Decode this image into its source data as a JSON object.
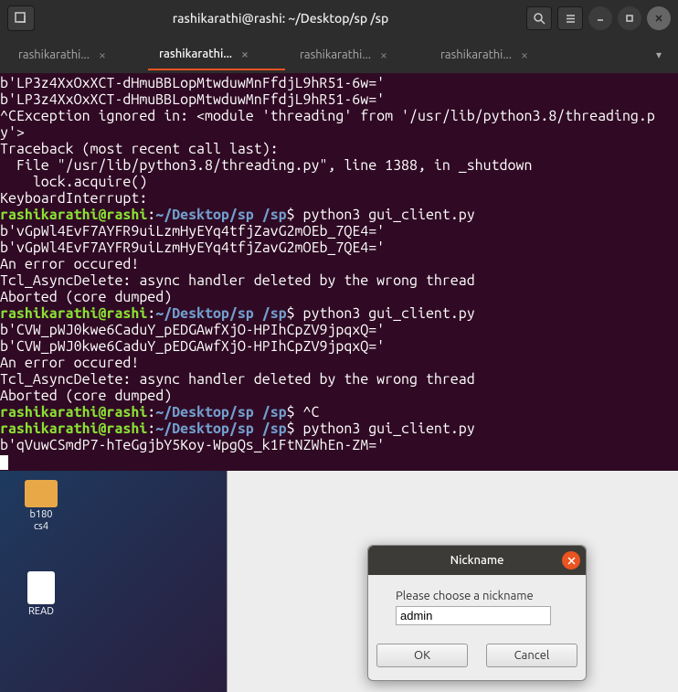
{
  "titlebar": {
    "title": "rashikarathi@rashi: ~/Desktop/sp /sp"
  },
  "tabs": [
    {
      "label": "rashikarathi...",
      "active": false
    },
    {
      "label": "rashikarathi...",
      "active": true
    },
    {
      "label": "rashikarathi...",
      "active": false
    },
    {
      "label": "rashikarathi...",
      "active": false
    }
  ],
  "terminal": {
    "lines": [
      {
        "type": "txt",
        "text": "b'LP3z4XxOxXCT-dHmuBBLopMtwduwMnFfdjL9hR51-6w='"
      },
      {
        "type": "txt",
        "text": "b'LP3z4XxOxXCT-dHmuBBLopMtwduwMnFfdjL9hR51-6w='"
      },
      {
        "type": "txt",
        "text": "^CException ignored in: <module 'threading' from '/usr/lib/python3.8/threading.p"
      },
      {
        "type": "txt",
        "text": "y'>"
      },
      {
        "type": "txt",
        "text": "Traceback (most recent call last):"
      },
      {
        "type": "txt",
        "text": "  File \"/usr/lib/python3.8/threading.py\", line 1388, in _shutdown"
      },
      {
        "type": "txt",
        "text": "    lock.acquire()"
      },
      {
        "type": "txt",
        "text": "KeyboardInterrupt:"
      },
      {
        "type": "prompt",
        "user": "rashikarathi@rashi",
        "path": "~/Desktop/sp /sp",
        "cmd": "python3 gui_client.py"
      },
      {
        "type": "txt",
        "text": "b'vGpWl4EvF7AYFR9uiLzmHyEYq4tfjZavG2mOEb_7QE4='"
      },
      {
        "type": "txt",
        "text": "b'vGpWl4EvF7AYFR9uiLzmHyEYq4tfjZavG2mOEb_7QE4='"
      },
      {
        "type": "txt",
        "text": "An error occured!"
      },
      {
        "type": "txt",
        "text": "Tcl_AsyncDelete: async handler deleted by the wrong thread"
      },
      {
        "type": "txt",
        "text": "Aborted (core dumped)"
      },
      {
        "type": "prompt",
        "user": "rashikarathi@rashi",
        "path": "~/Desktop/sp /sp",
        "cmd": "python3 gui_client.py"
      },
      {
        "type": "txt",
        "text": "b'CVW_pWJ0kwe6CaduY_pEDGAwfXjO-HPIhCpZV9jpqxQ='"
      },
      {
        "type": "txt",
        "text": "b'CVW_pWJ0kwe6CaduY_pEDGAwfXjO-HPIhCpZV9jpqxQ='"
      },
      {
        "type": "txt",
        "text": "An error occured!"
      },
      {
        "type": "txt",
        "text": "Tcl_AsyncDelete: async handler deleted by the wrong thread"
      },
      {
        "type": "txt",
        "text": "Aborted (core dumped)"
      },
      {
        "type": "prompt",
        "user": "rashikarathi@rashi",
        "path": "~/Desktop/sp /sp",
        "cmd": "^C"
      },
      {
        "type": "prompt",
        "user": "rashikarathi@rashi",
        "path": "~/Desktop/sp /sp",
        "cmd": "python3 gui_client.py"
      },
      {
        "type": "txt",
        "text": "b'qVuwCSmdP7-hTeGgjbY5Koy-WpgQs_k1FtNZWhEn-ZM='"
      }
    ]
  },
  "desktop": {
    "icon1": {
      "line1": "b180",
      "line2": "cs4"
    },
    "icon2": {
      "line1": "READ"
    }
  },
  "dialog": {
    "title": "Nickname",
    "label": "Please choose a nickname",
    "value": "admin",
    "ok": "OK",
    "cancel": "Cancel"
  }
}
